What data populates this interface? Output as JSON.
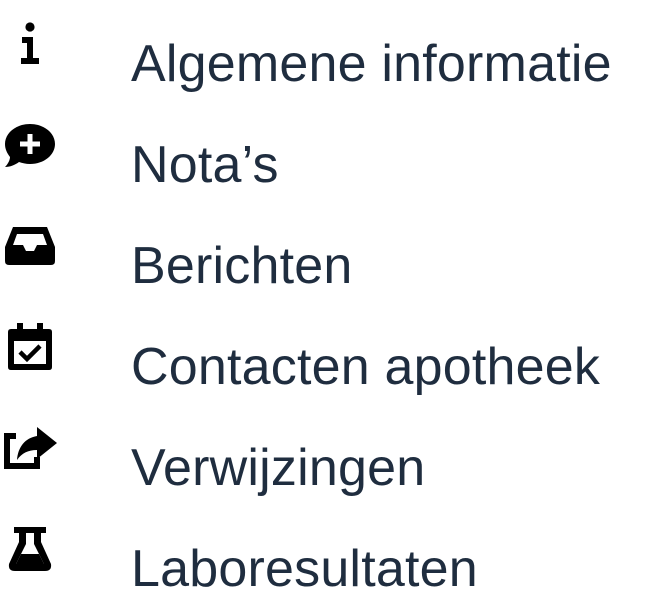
{
  "menu": {
    "items": [
      {
        "label": "Algemene informatie",
        "icon": "info-icon"
      },
      {
        "label": "Nota’s",
        "icon": "comment-plus-icon"
      },
      {
        "label": "Berichten",
        "icon": "inbox-icon"
      },
      {
        "label": "Contacten apotheek",
        "icon": "calendar-check-icon"
      },
      {
        "label": "Verwijzingen",
        "icon": "share-square-icon"
      },
      {
        "label": "Laboresultaten",
        "icon": "flask-icon"
      }
    ]
  },
  "colors": {
    "text": "#1f2d3f",
    "icon": "#000000",
    "background": "#ffffff"
  }
}
